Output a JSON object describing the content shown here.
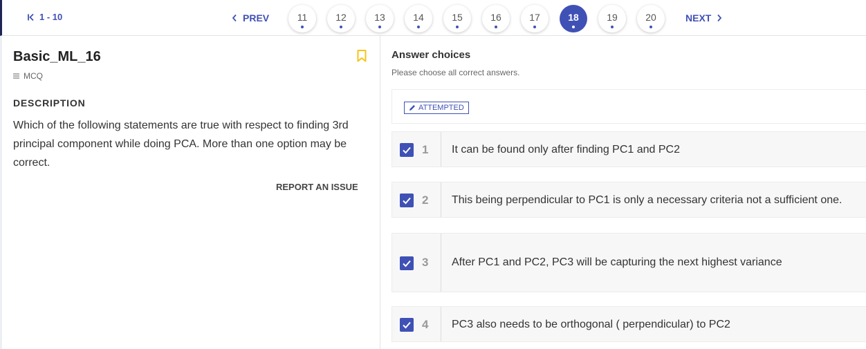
{
  "nav": {
    "range_label": "1 - 10",
    "prev_label": "PREV",
    "next_label": "NEXT",
    "pages": [
      "11",
      "12",
      "13",
      "14",
      "15",
      "16",
      "17",
      "18",
      "19",
      "20"
    ],
    "active_page": "18",
    "accent_color": "#3f51b5"
  },
  "question": {
    "title": "Basic_ML_16",
    "type": "MCQ",
    "description_heading": "DESCRIPTION",
    "description": "Which of the following statements are true with respect to finding 3rd principal component while doing PCA. More than one option may be correct.",
    "report_label": "REPORT AN ISSUE",
    "bookmark_color": "#f5c518"
  },
  "answers": {
    "heading": "Answer choices",
    "subheading": "Please choose all correct answers.",
    "status": "ATTEMPTED",
    "options": [
      {
        "num": "1",
        "text": "It can be found only after finding PC1 and PC2",
        "checked": true
      },
      {
        "num": "2",
        "text": "This being perpendicular to PC1 is only a necessary criteria not a sufficient one.",
        "checked": true
      },
      {
        "num": "3",
        "text": "After PC1 and PC2,  PC3 will be capturing the next highest variance",
        "checked": true
      },
      {
        "num": "4",
        "text": "PC3 also needs to be orthogonal ( perpendicular) to PC2",
        "checked": true
      }
    ]
  }
}
